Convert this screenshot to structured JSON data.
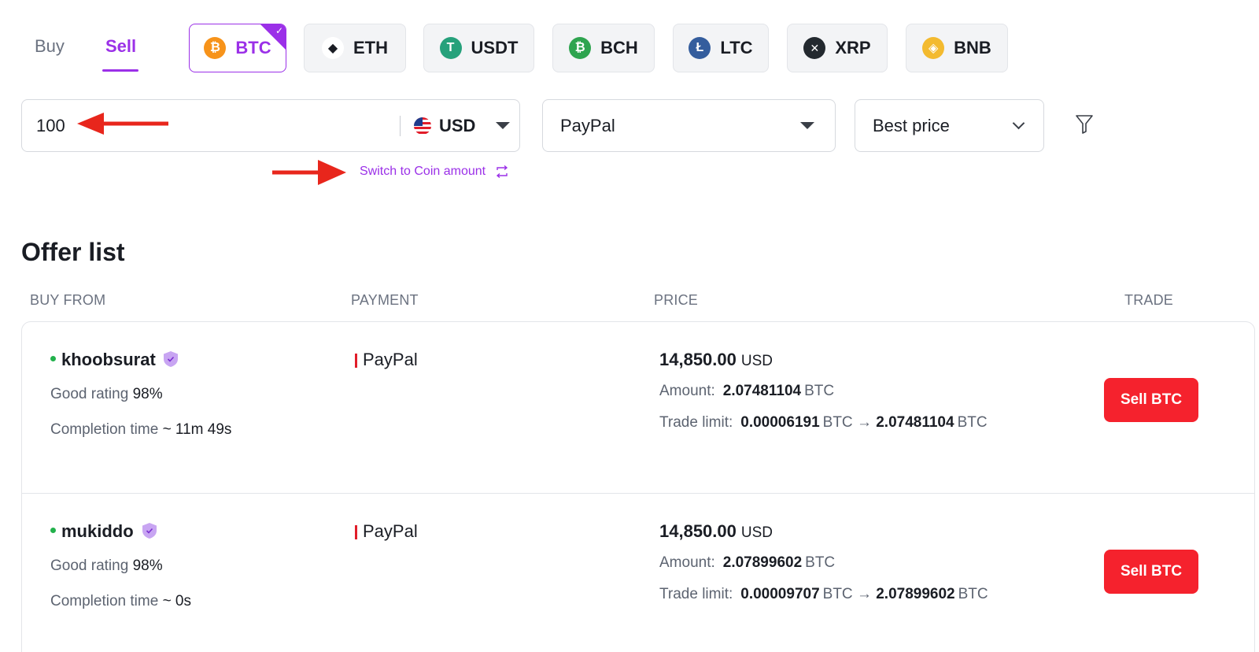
{
  "side_tabs": {
    "buy": "Buy",
    "sell": "Sell",
    "active": "sell"
  },
  "coins": [
    {
      "symbol": "BTC",
      "glyph": "₿",
      "color": "#f7931a",
      "selected": true
    },
    {
      "symbol": "ETH",
      "glyph": "◆",
      "color": "#ffffff",
      "selected": false
    },
    {
      "symbol": "USDT",
      "glyph": "T",
      "color": "#26a17b",
      "selected": false
    },
    {
      "symbol": "BCH",
      "glyph": "₿",
      "color": "#2ea44f",
      "selected": false
    },
    {
      "symbol": "LTC",
      "glyph": "Ł",
      "color": "#345d9d",
      "selected": false
    },
    {
      "symbol": "XRP",
      "glyph": "✕",
      "color": "#23292f",
      "selected": false
    },
    {
      "symbol": "BNB",
      "glyph": "◈",
      "color": "#f3ba2f",
      "selected": false
    }
  ],
  "amount_input": {
    "value": "100",
    "currency": "USD"
  },
  "payment_select": {
    "value": "PayPal"
  },
  "sort_select": {
    "value": "Best price"
  },
  "switch_link": "Switch to Coin amount",
  "offer_list": {
    "title": "Offer list",
    "columns": {
      "buy_from": "BUY FROM",
      "payment": "PAYMENT",
      "price": "PRICE",
      "trade": "TRADE"
    },
    "offers": [
      {
        "trader": "khoobsurat",
        "rating_label": "Good rating",
        "rating": "98%",
        "completion_label": "Completion time",
        "completion": "~ 11m 49s",
        "payment": "PayPal",
        "price": "14,850.00",
        "price_unit": "USD",
        "amount_label": "Amount:",
        "amount": "2.07481104",
        "amount_unit": "BTC",
        "limit_label": "Trade limit:",
        "limit_min": "0.00006191",
        "limit_max": "2.07481104",
        "limit_unit": "BTC",
        "button": "Sell BTC"
      },
      {
        "trader": "mukiddo",
        "rating_label": "Good rating",
        "rating": "98%",
        "completion_label": "Completion time",
        "completion": "~ 0s",
        "payment": "PayPal",
        "price": "14,850.00",
        "price_unit": "USD",
        "amount_label": "Amount:",
        "amount": "2.07899602",
        "amount_unit": "BTC",
        "limit_label": "Trade limit:",
        "limit_min": "0.00009707",
        "limit_max": "2.07899602",
        "limit_unit": "BTC",
        "button": "Sell BTC"
      }
    ]
  },
  "colors": {
    "accent": "#9b30e8",
    "sell_button": "#f5222d",
    "annotation_arrow": "#e8261c",
    "online": "#22b14c"
  }
}
